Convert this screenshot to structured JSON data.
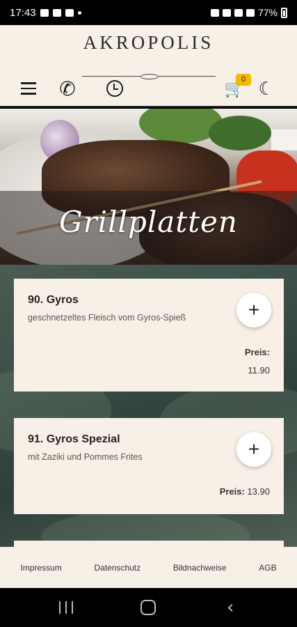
{
  "status_bar": {
    "time": "17:43",
    "battery": "77%"
  },
  "header": {
    "logo": "AKROPOLIS",
    "cart_count": "0"
  },
  "hero": {
    "title": "Grillplatten"
  },
  "menu": {
    "items": [
      {
        "name": "90. Gyros",
        "description": "geschnetzeltes Fleisch vom Gyros-Spieß",
        "price_label": "Preis:",
        "price": "11.90"
      },
      {
        "name": "91. Gyros Spezial",
        "description": "mit Zaziki und Pommes Frites",
        "price_label": "Preis:",
        "price": "13.90"
      }
    ],
    "add_label": "+"
  },
  "footer": {
    "links": [
      "Impressum",
      "Datenschutz",
      "Bildnachweise",
      "AGB"
    ]
  },
  "icons": [
    "menu-icon",
    "phone-icon",
    "clock-icon",
    "cart-icon",
    "moon-icon",
    "plus-icon"
  ],
  "colors": {
    "header_bg": "#f7f0e6",
    "card_bg": "#f8f0e6",
    "badge": "#f5b800"
  }
}
